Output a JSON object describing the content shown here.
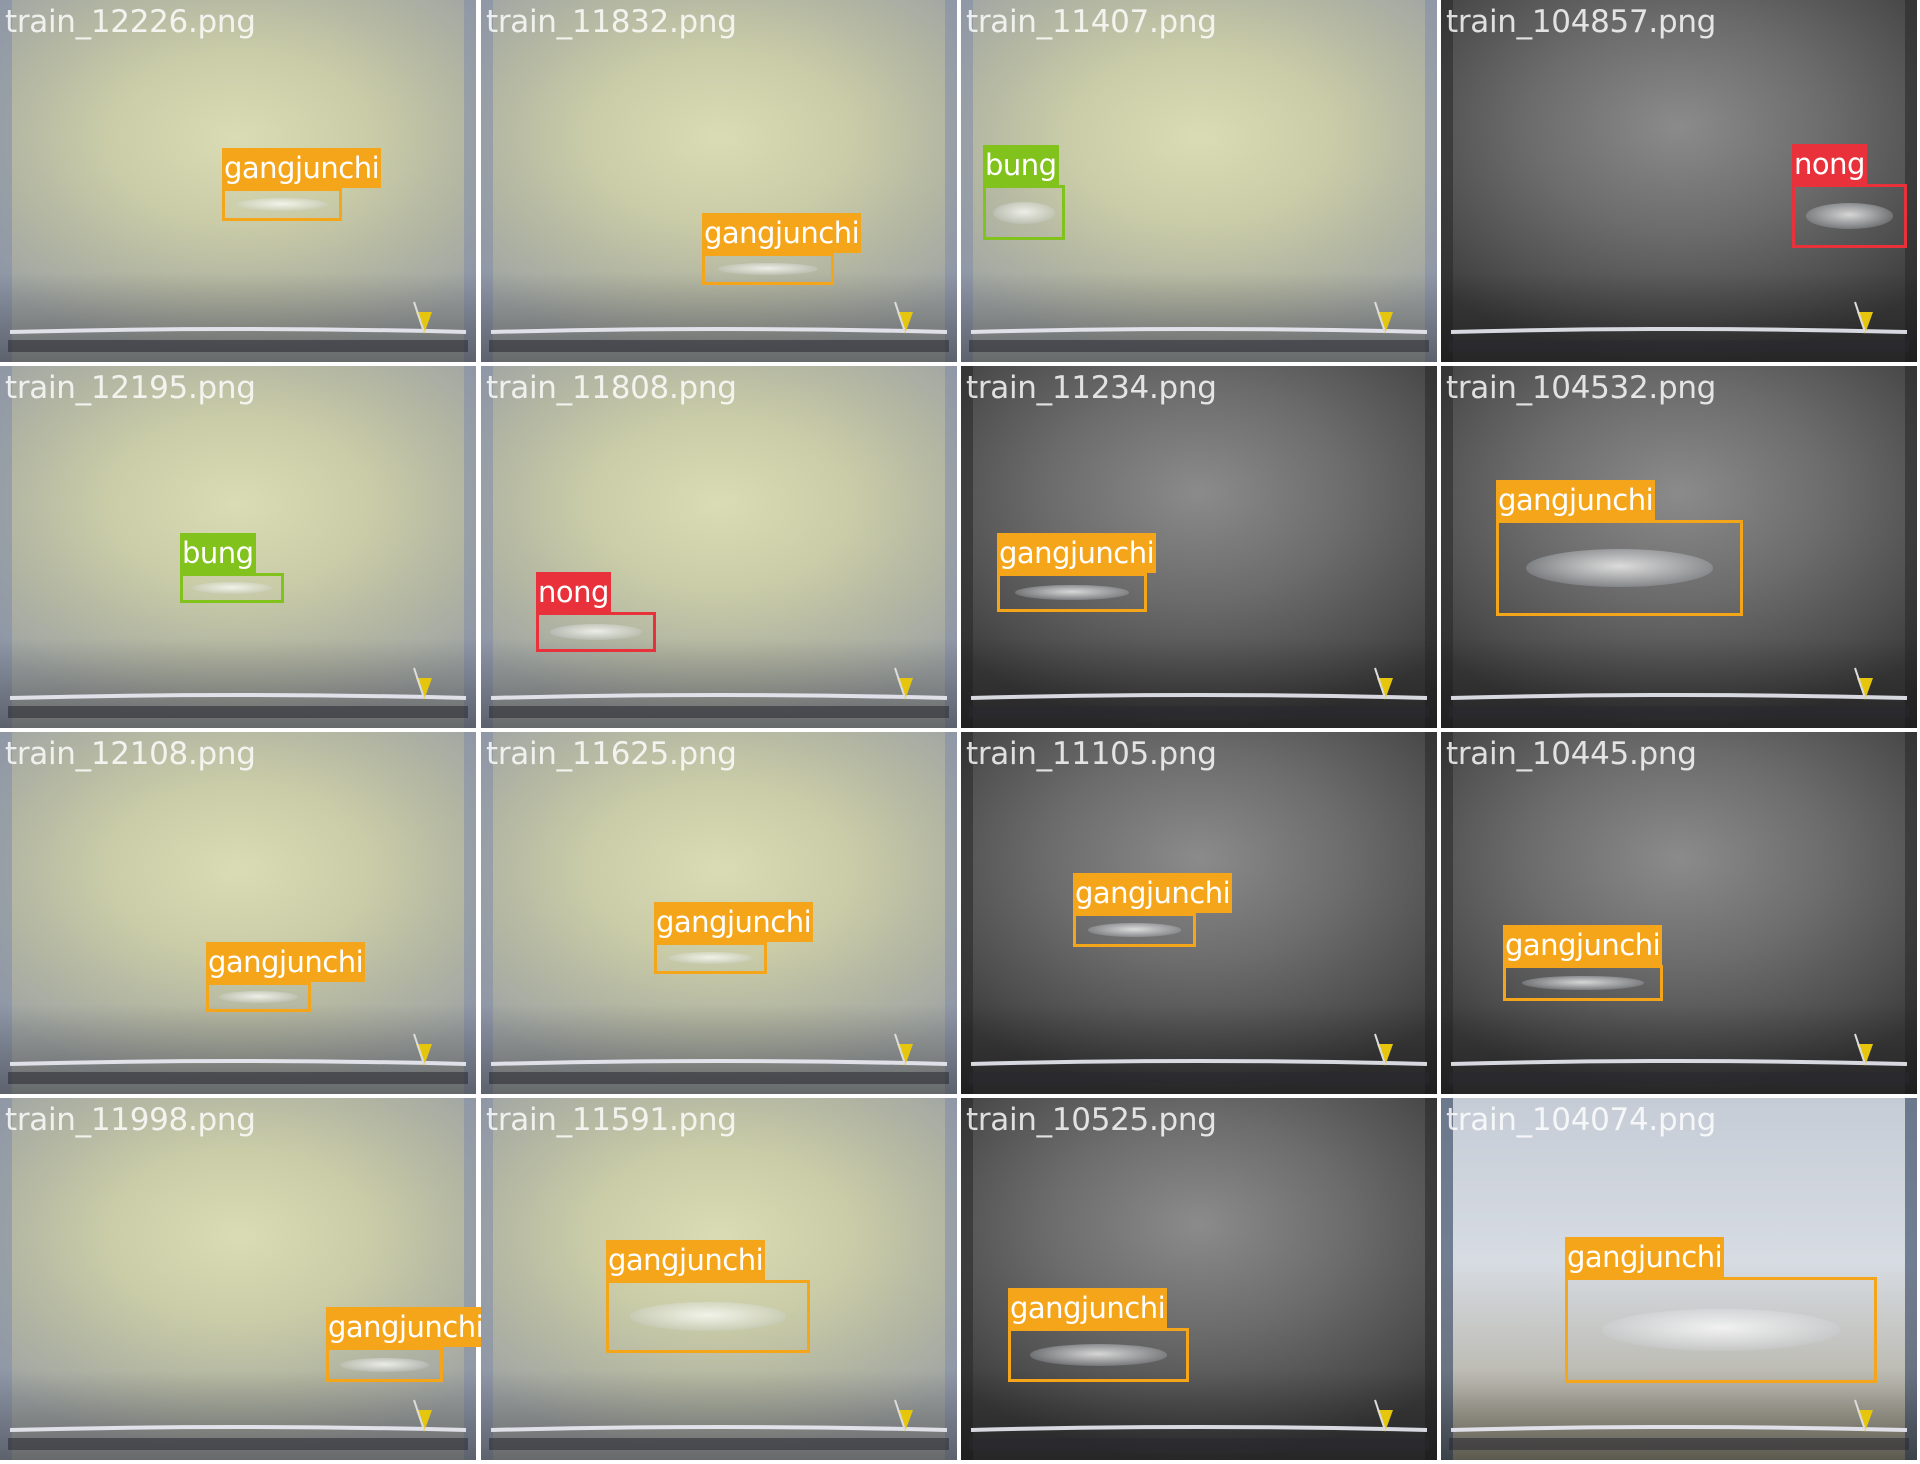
{
  "class_colors": {
    "gangjunchi": "#f5a51a",
    "bung": "#82c21c",
    "nong": "#e8313a"
  },
  "tiles": [
    {
      "filename": "train_12226.png",
      "scene": "yellow",
      "boxes": [
        {
          "label": "gangjunchi"
        }
      ]
    },
    {
      "filename": "train_11832.png",
      "scene": "yellow",
      "boxes": [
        {
          "label": "gangjunchi"
        }
      ]
    },
    {
      "filename": "train_11407.png",
      "scene": "yellow",
      "boxes": [
        {
          "label": "bung"
        }
      ]
    },
    {
      "filename": "train_104857.png",
      "scene": "gray",
      "boxes": [
        {
          "label": "nong"
        }
      ]
    },
    {
      "filename": "train_12195.png",
      "scene": "yellow",
      "boxes": [
        {
          "label": "bung"
        }
      ]
    },
    {
      "filename": "train_11808.png",
      "scene": "yellow",
      "boxes": [
        {
          "label": "nong"
        }
      ]
    },
    {
      "filename": "train_11234.png",
      "scene": "gray",
      "boxes": [
        {
          "label": "gangjunchi"
        }
      ]
    },
    {
      "filename": "train_104532.png",
      "scene": "gray",
      "boxes": [
        {
          "label": "gangjunchi"
        }
      ]
    },
    {
      "filename": "train_12108.png",
      "scene": "yellow",
      "boxes": [
        {
          "label": "gangjunchi"
        }
      ]
    },
    {
      "filename": "train_11625.png",
      "scene": "yellow",
      "boxes": [
        {
          "label": "gangjunchi"
        }
      ]
    },
    {
      "filename": "train_11105.png",
      "scene": "gray",
      "boxes": [
        {
          "label": "gangjunchi"
        }
      ]
    },
    {
      "filename": "train_10445.png",
      "scene": "gray",
      "boxes": [
        {
          "label": "gangjunchi"
        }
      ]
    },
    {
      "filename": "train_11998.png",
      "scene": "yellow",
      "boxes": [
        {
          "label": "gangjunchi"
        }
      ]
    },
    {
      "filename": "train_11591.png",
      "scene": "yellow",
      "boxes": [
        {
          "label": "gangjunchi"
        }
      ]
    },
    {
      "filename": "train_10525.png",
      "scene": "gray",
      "boxes": [
        {
          "label": "gangjunchi"
        }
      ]
    },
    {
      "filename": "train_104074.png",
      "scene": "bright",
      "boxes": [
        {
          "label": "gangjunchi"
        }
      ]
    }
  ]
}
